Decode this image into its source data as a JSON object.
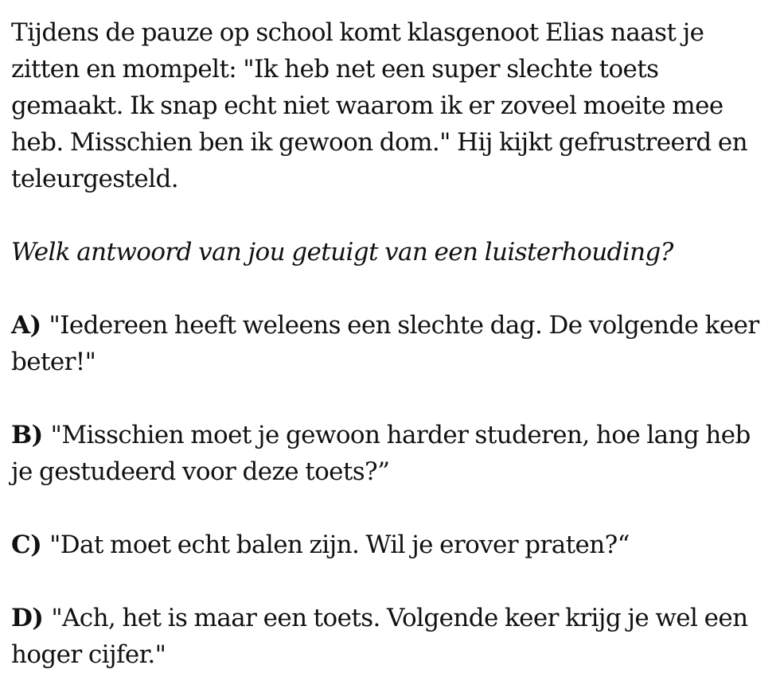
{
  "scenario": "Tijdens de pauze op school komt klasgenoot Elias naast je zitten en mompelt: \"Ik heb net een super slechte toets gemaakt. Ik snap echt niet waarom ik er zoveel moeite mee heb. Misschien ben ik gewoon dom.\" Hij kijkt gefrustreerd en teleurgesteld.",
  "question": "Welk antwoord van jou getuigt van een luisterhouding?",
  "options": [
    {
      "letter": "A)",
      "text": "\"Iedereen heeft weleens een slechte dag. De volgende keer beter!\""
    },
    {
      "letter": "B)",
      "text": "\"Misschien moet je gewoon harder studeren, hoe lang heb je gestudeerd voor deze toets?”"
    },
    {
      "letter": "C)",
      "text": "\"Dat moet echt balen zijn. Wil je erover praten?“"
    },
    {
      "letter": "D)",
      "text": "\"Ach, het is maar een toets. Volgende keer krijg je wel een hoger cijfer.\""
    }
  ]
}
